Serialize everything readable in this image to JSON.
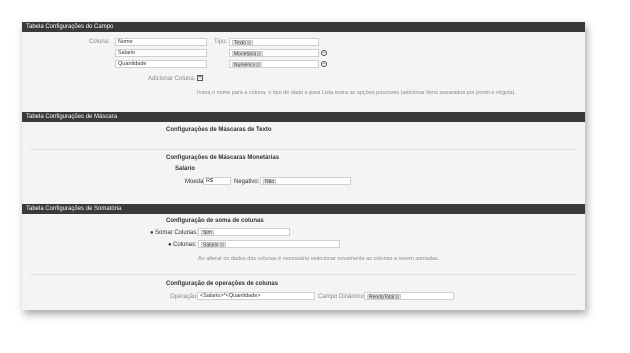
{
  "campo": {
    "header": "Tabela Configurações do Campo",
    "coluna_label": "Coluna:",
    "tipo_label": "Tipo:",
    "rows": [
      {
        "coluna": "Nome",
        "tipo": "Texto"
      },
      {
        "coluna": "Salario",
        "tipo": "Monetária"
      },
      {
        "coluna": "Quantidade",
        "tipo": "Numérico"
      }
    ],
    "adicionar_label": "Adicionar Coluna:",
    "hint": "Insira o nome para a coluna, o tipo de dado e para Lista insira as opções possíveis (adicionar itens separados por ponto e vírgula)."
  },
  "mascara": {
    "header": "Tabela Configurações de Máscara",
    "texto_title": "Configurações de Máscaras de Texto",
    "monetaria_title": "Configurações de Máscaras Monetárias",
    "field_name": "Salario",
    "moeda_label": "Moeda:",
    "moeda_value": "R$",
    "negativo_label": "Negativo:",
    "negativo_value": "Não"
  },
  "somatoria": {
    "header": "Tabela Configurações de Somatória",
    "soma_title": "Configuração de soma de colunas",
    "somar_label": "Somar Colunas:",
    "somar_value": "Sim",
    "colunas_label": "Colunas:",
    "colunas_value": "Salario",
    "warning": "Ao alterar os dados das colunas é necessário selecionar novamente as colunas a serem somadas.",
    "operacoes_title": "Configuração de operações de colunas",
    "operacao_label": "Operação:",
    "operacao_value": "<Salario>*<Quantidade>",
    "campo_label": "Campo Dinâmico:",
    "campo_value": "RendaTotal"
  },
  "icons": {
    "remove": "minus-circle-icon",
    "add": "plus-square-icon",
    "tag_remove": "tag-close-icon"
  }
}
